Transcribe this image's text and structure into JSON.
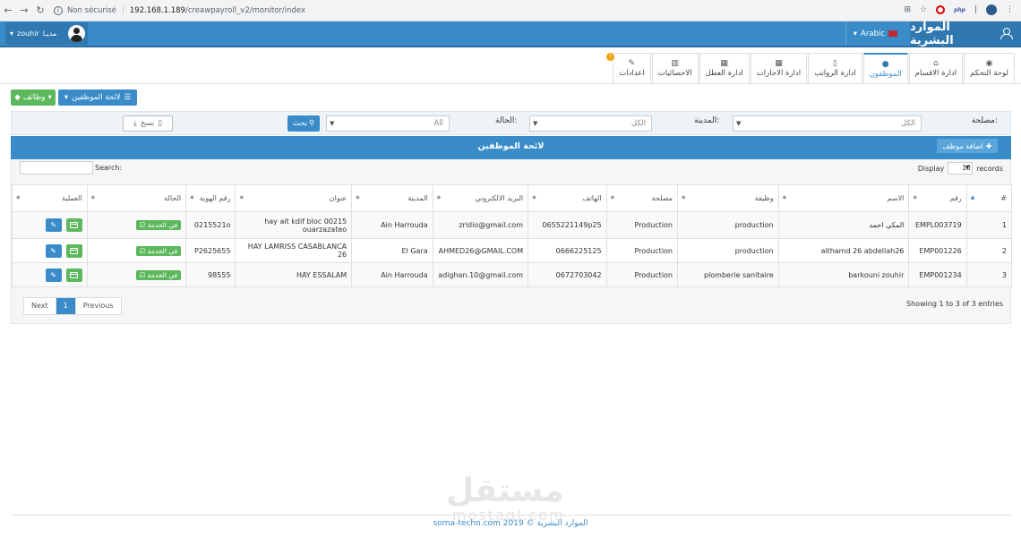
{
  "browser": {
    "security": "Non sécurisé",
    "url_host": "192.168.1.189",
    "url_path": "/creawpayroll_v2/monitor/index",
    "php_badge": "php"
  },
  "header": {
    "brand": "الموارد البشرية",
    "language": "Arabic",
    "user_name": "zouhir",
    "user_role": "مديـا"
  },
  "tabs": [
    {
      "label": "لوحة التحكم",
      "icon": "dashboard-icon",
      "glyph": "◉"
    },
    {
      "label": "ادارة الاقسام",
      "icon": "home-icon",
      "glyph": "⌂"
    },
    {
      "label": "الموظفون",
      "icon": "user-icon",
      "glyph": "●",
      "active": true
    },
    {
      "label": "ادارة الرواتب",
      "icon": "payroll-icon",
      "glyph": "▯"
    },
    {
      "label": "ادارة الاجازات",
      "icon": "calendar-badge-icon",
      "glyph": "▦",
      "badge": "!"
    },
    {
      "label": "ادارة العطل",
      "icon": "calendar-icon",
      "glyph": "▦"
    },
    {
      "label": "الاحصائيات",
      "icon": "bar-chart-icon",
      "glyph": "▥"
    },
    {
      "label": "اعدادات",
      "icon": "wrench-icon",
      "glyph": "✎"
    }
  ],
  "actions": {
    "jobs_button": "وظائف",
    "employee_list_button": "لائحة الموظفين"
  },
  "filters": {
    "department_label": "مصلحة:",
    "department_value": "الكل",
    "city_label": "المدينة:",
    "city_value": "الكل",
    "status_label": "الحالة:",
    "status_value": "All",
    "search_button": "بحث",
    "copy_button": "نسخ"
  },
  "list": {
    "title": "لائحة الموظفين",
    "add_button": "اضافة موظف",
    "display_label": "Display",
    "records_value": "10",
    "records_label": "records",
    "search_label": "Search:",
    "showing": "Showing 1 to 3 of 3 entries"
  },
  "table": {
    "headers": [
      "#",
      "رقم",
      "الاسم",
      "وظيفة",
      "مصلحة",
      "الهاتف",
      "البريد الالكتروني",
      "المدينة",
      "عنوان",
      "رقم الهوية",
      "الحالة",
      "العملية"
    ],
    "rows": [
      {
        "n": "1",
        "code": "EMPL003719",
        "name": "المكي احمد",
        "job": "production",
        "dept": "Production",
        "phone": "0655221149p25",
        "email": "zridio@gmail.com",
        "city": "Ain Harrouda",
        "address": "hay ait kdif bloc 00215 ouarzazateo",
        "id": "0215521o",
        "status": "في الخدمة"
      },
      {
        "n": "2",
        "code": "EMP001226",
        "name": "aithamd 26 abdellah26",
        "job": "production",
        "dept": "Production",
        "phone": "0666225125",
        "email": "AHMED26@GMAIL.COM",
        "city": "El Gara",
        "address": "HAY LAMRISS CASABLANCA 26",
        "id": "P2625655",
        "status": "في الخدمة"
      },
      {
        "n": "3",
        "code": "EMP001234",
        "name": "barkouni zouhir",
        "job": "plomberie sanitaire",
        "dept": "Production",
        "phone": "0672703042",
        "email": "adighan.10@gmail.com",
        "city": "Ain Harrouda",
        "address": "HAY ESSALAM",
        "id": "98555",
        "status": "في الخدمة"
      }
    ]
  },
  "pager": {
    "next": "Next",
    "current": "1",
    "previous": "Previous"
  },
  "watermark": {
    "arabic": "مستقل",
    "latin": "mostaql.com"
  },
  "footer": "soma-techn.com 2019 © الموارد البشرية",
  "colors": {
    "primary": "#3a8cc9",
    "success": "#5cb85c",
    "badge": "#f0a30a"
  }
}
